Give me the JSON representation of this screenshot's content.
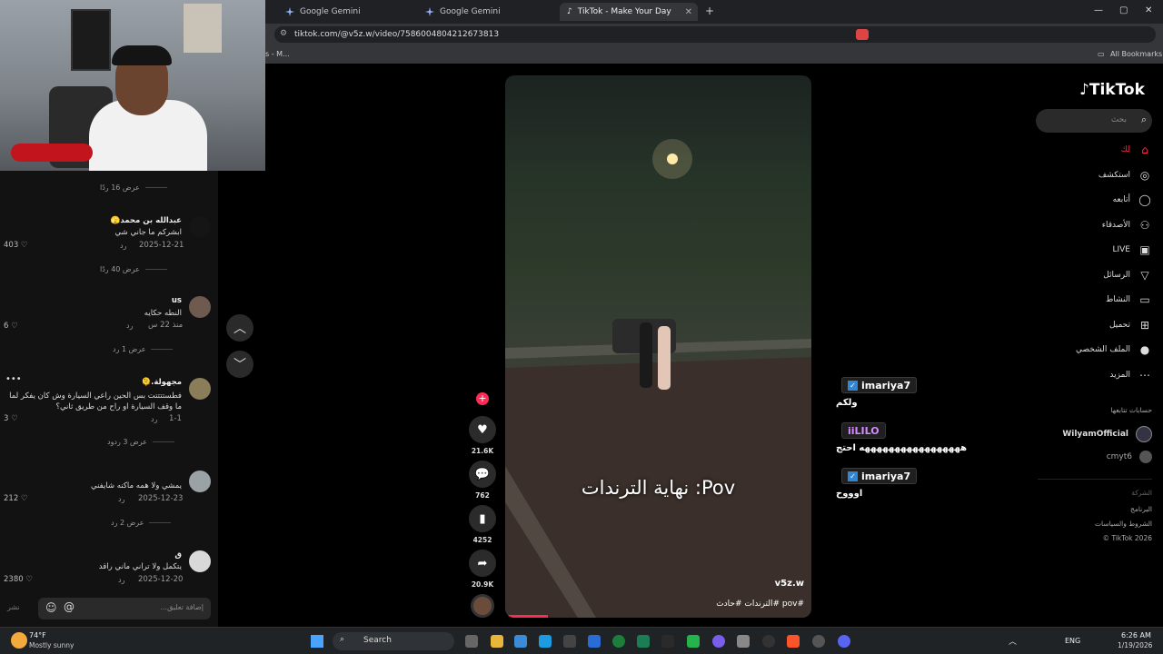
{
  "tabs": [
    {
      "label": "Google Gemini",
      "icon": "gemini-icon",
      "active": false
    },
    {
      "label": "Google Gemini",
      "icon": "gemini-icon",
      "active": false
    },
    {
      "label": "TikTok - Make Your Day",
      "icon": "tiktok-icon",
      "active": true
    }
  ],
  "address": {
    "url": "tiktok.com/@v5z.w/video/7586004804212673813"
  },
  "bookmarks": {
    "left_fragment": "s - M...",
    "all_bookmarks": "All Bookmarks"
  },
  "comments": {
    "items": [
      {
        "view_more": "عرض 16 ردًا"
      },
      {
        "user": "عبدالله بن محمد🫣",
        "text": "ابشركم ما جاني شي",
        "date": "2025-12-21",
        "reply": "رد",
        "likes": "403"
      },
      {
        "view_more": "عرض 40 ردًا"
      },
      {
        "user": "us",
        "text": "النطه حكايه",
        "date": "منذ 22 س",
        "reply": "رد",
        "likes": "6"
      },
      {
        "view_more": "عرض 1 رد"
      },
      {
        "user": "مجهولة.🫠",
        "text": "فطستتتتت بس الحين راعي السيارة وش كان يفكر لما ما وقف السيارة او راح من طريق ثاني؟",
        "date": "1-1",
        "reply": "رد",
        "likes": "3"
      },
      {
        "view_more": "عرض 3 ردود"
      },
      {
        "user": "",
        "text": "يمشي ولا همه ماكنه شايفني",
        "date": "2025-12-23",
        "reply": "رد",
        "likes": "212"
      },
      {
        "view_more": "عرض 2 رد"
      },
      {
        "user": "ق",
        "text": "يتكمل ولا تراني ماني راقد",
        "date": "2025-12-20",
        "reply": "رد",
        "likes": "2380"
      }
    ],
    "input_placeholder": "إضافة تعليق...",
    "post_label": "نشر"
  },
  "video": {
    "caption": "نهاية الترندات :Pov",
    "username": "v5z.w",
    "tags": "#pov #الترندات #حادث",
    "progress": 0.14
  },
  "actions": {
    "likes": "21.6K",
    "comments": "762",
    "saves": "4252",
    "shares": "20.9K"
  },
  "chat": [
    {
      "name": "imariya7",
      "msg": "ولكم",
      "badge": true
    },
    {
      "name": "iiLILO",
      "msg": "هههههههههههههههههه احتج",
      "badge": false
    },
    {
      "name": "imariya7",
      "msg": "اوووح",
      "badge": true
    }
  ],
  "sidebar": {
    "logo": "TikTok",
    "search_placeholder": "بحث",
    "items": [
      {
        "label": "لك",
        "icon": "home-icon"
      },
      {
        "label": "استكشف",
        "icon": "compass-icon"
      },
      {
        "label": "أتابعه",
        "icon": "following-icon"
      },
      {
        "label": "الأصدقاء",
        "icon": "friends-icon"
      },
      {
        "label": "LIVE",
        "icon": "live-icon"
      },
      {
        "label": "الرسائل",
        "icon": "messages-icon"
      },
      {
        "label": "النشاط",
        "icon": "activity-icon"
      },
      {
        "label": "تحميل",
        "icon": "upload-icon"
      },
      {
        "label": "الملف الشخصي",
        "icon": "profile-icon"
      },
      {
        "label": "المزيد",
        "icon": "more-icon"
      }
    ],
    "following_heading": "حسابات تتابعها",
    "following": [
      "WilyamOfficial",
      "cmyt6"
    ],
    "footer": [
      "الشركة",
      "البرنامج",
      "الشروط والسياسات",
      "TikTok 2026 ©"
    ]
  },
  "taskbar": {
    "weather_temp": "74°F",
    "weather_desc": "Mostly sunny",
    "search_label": "Search",
    "lang": "ENG",
    "time": "6:26 AM",
    "date": "1/19/2026"
  },
  "colors": {
    "accent": "#fe2c55",
    "background": "#000000",
    "panel": "#121212"
  }
}
